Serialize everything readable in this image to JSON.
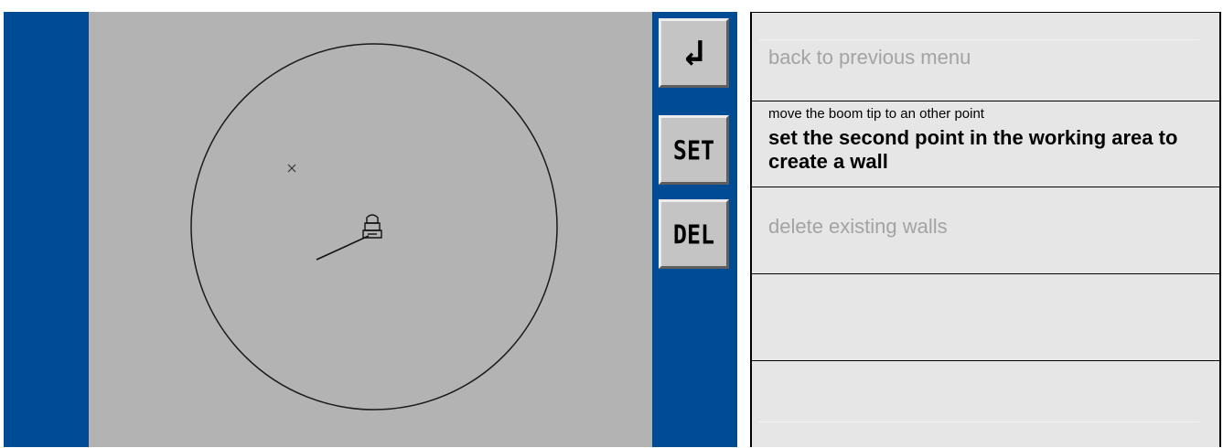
{
  "buttons": {
    "back": {
      "label": "↲",
      "icon": "return-arrow-icon"
    },
    "set": {
      "label": "SET"
    },
    "del": {
      "label": "DEL"
    }
  },
  "help": {
    "back_desc": "back to previous menu",
    "set_hint": "move the boom tip to an other point",
    "set_desc": "set the second point in the working area to create a wall",
    "del_desc": "delete existing walls"
  },
  "colors": {
    "frame": "#004c94",
    "work_area": "#b3b3b3",
    "button_face": "#c4c4c4",
    "help_bg": "#e6e6e6",
    "inactive_text": "#a3a3a3"
  }
}
